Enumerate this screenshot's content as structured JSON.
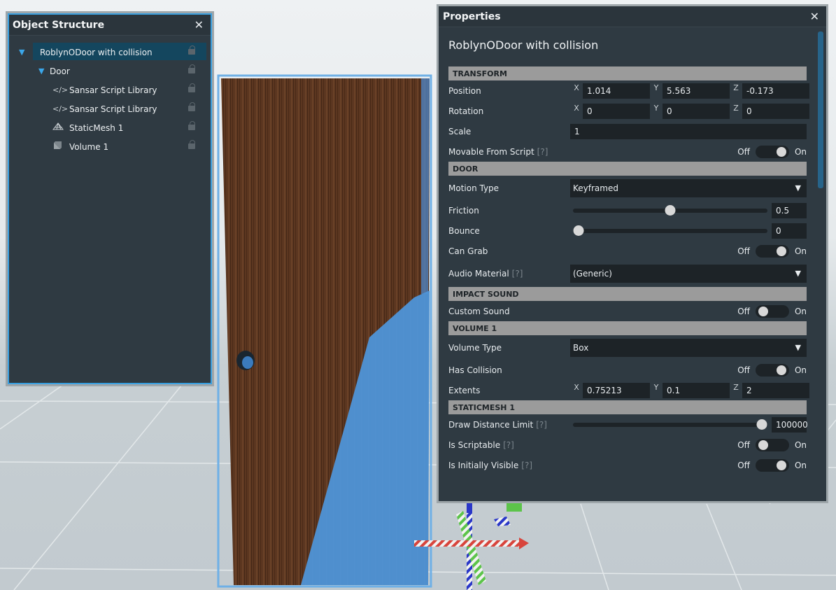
{
  "object_structure": {
    "title": "Object Structure",
    "items": [
      {
        "label": "RoblynODoor with collision",
        "icon": "triangle-down",
        "level": 0,
        "selected": true
      },
      {
        "label": "Door",
        "icon": "triangle-down",
        "level": 1
      },
      {
        "label": "Sansar Script Library",
        "icon": "code-icon",
        "level": 2
      },
      {
        "label": "Sansar Script Library",
        "icon": "code-icon",
        "level": 2
      },
      {
        "label": "StaticMesh 1",
        "icon": "mesh-icon",
        "level": 2
      },
      {
        "label": "Volume 1",
        "icon": "volume-icon",
        "level": 2
      }
    ]
  },
  "properties": {
    "title": "Properties",
    "object_name": "RoblynODoor with collision",
    "help_marker": "[?]",
    "off_label": "Off",
    "on_label": "On",
    "axis": {
      "x": "X",
      "y": "Y",
      "z": "Z"
    },
    "transform": {
      "section": "TRANSFORM",
      "position": {
        "label": "Position",
        "x": "1.014",
        "y": "5.563",
        "z": "-0.173"
      },
      "rotation": {
        "label": "Rotation",
        "x": "0",
        "y": "0",
        "z": "0"
      },
      "scale": {
        "label": "Scale",
        "value": "1"
      },
      "movable": {
        "label": "Movable From Script",
        "on": true
      }
    },
    "door": {
      "section": "DOOR",
      "motion_type": {
        "label": "Motion Type",
        "value": "Keyframed"
      },
      "friction": {
        "label": "Friction",
        "value": "0.5",
        "fraction": 0.5
      },
      "bounce": {
        "label": "Bounce",
        "value": "0",
        "fraction": 0.0
      },
      "can_grab": {
        "label": "Can Grab",
        "on": true
      },
      "audio_material": {
        "label": "Audio Material",
        "value": "(Generic)"
      }
    },
    "impact_sound": {
      "section": "IMPACT SOUND",
      "custom_sound": {
        "label": "Custom Sound",
        "on": false
      }
    },
    "volume": {
      "section": "VOLUME 1",
      "volume_type": {
        "label": "Volume Type",
        "value": "Box"
      },
      "has_collision": {
        "label": "Has Collision",
        "on": true
      },
      "extents": {
        "label": "Extents",
        "x": "0.75213",
        "y": "0.1",
        "z": "2"
      }
    },
    "staticmesh": {
      "section": "STATICMESH 1",
      "draw_distance": {
        "label": "Draw Distance Limit",
        "value": "100000",
        "fraction": 1.0
      },
      "is_scriptable": {
        "label": "Is Scriptable",
        "on": false
      },
      "is_initially_visible": {
        "label": "Is Initially Visible",
        "on": true
      }
    }
  },
  "colors": {
    "accent": "#3aa0e0",
    "panel_bg": "#2f3a42",
    "section_bg": "#9b9b9b",
    "field_bg": "#1d2327",
    "door_wood": "#5a3520",
    "selection_highlight": "#4a90d9"
  }
}
